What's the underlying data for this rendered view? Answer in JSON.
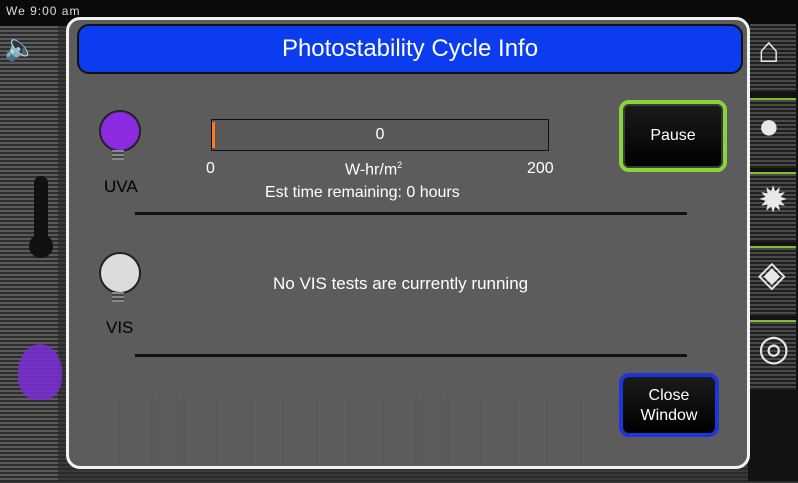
{
  "background": {
    "clock_text": "We 9:00 am"
  },
  "dialog": {
    "title": "Photostability Cycle Info",
    "uva": {
      "label": "UVA",
      "progress_value": "0",
      "progress_fraction": 0,
      "scale_min": "0",
      "scale_unit": "W-hr/m",
      "scale_unit_sup": "2",
      "scale_max": "200",
      "est_time": "Est time remaining: 0 hours"
    },
    "vis": {
      "label": "VIS",
      "status": "No VIS tests are currently running"
    },
    "pause_label": "Pause",
    "close_label_line1": "Close",
    "close_label_line2": "Window"
  },
  "colors": {
    "title_bar": "#0b3cf0",
    "pause_border": "#8ad43a",
    "close_border": "#1f35d8",
    "uva_bulb": "#8a2be2",
    "vis_bulb": "#dcdcdc",
    "progress_marker": "#ff7a1a"
  },
  "icons": {
    "speaker": "speaker-icon",
    "home": "home-icon",
    "thermometer": "thermometer-icon",
    "bulb": "light-bulb-icon"
  }
}
